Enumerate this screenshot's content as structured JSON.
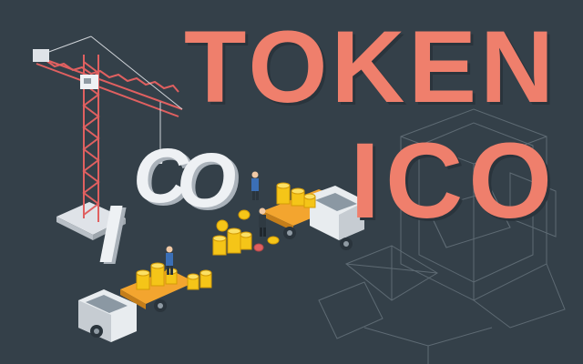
{
  "headline": {
    "line1": "TOKEN",
    "line2": "ICO"
  },
  "sign": {
    "letters": [
      "I",
      "C",
      "O"
    ]
  },
  "colors": {
    "background": "#344049",
    "headline": "#ef7f6c",
    "coin": "#f5c518",
    "crane": "#e06060",
    "letter": "#eef1f4"
  },
  "illustration": {
    "crane": "tower-crane-icon",
    "truck_left": "flatbed-truck-icon",
    "truck_right": "flatbed-truck-icon",
    "coins": "gold-coin-stack-icon",
    "workers": "worker-figure-icon",
    "blueprint": "wireframe-outline-icon"
  }
}
